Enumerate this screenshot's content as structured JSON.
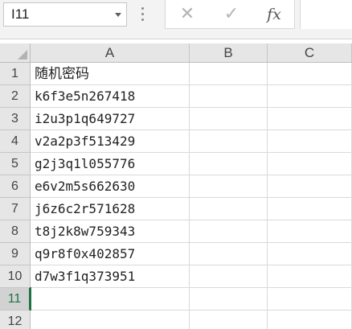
{
  "name_box": {
    "value": "I11"
  },
  "formula_bar": {
    "cancel_icon": "cancel-x-icon",
    "confirm_icon": "check-icon",
    "fx_label": "fx",
    "value": ""
  },
  "columns": [
    "A",
    "B",
    "C"
  ],
  "rows": [
    {
      "num": "1",
      "a": "随机密码"
    },
    {
      "num": "2",
      "a": "k6f3e5n267418"
    },
    {
      "num": "3",
      "a": "i2u3p1q649727"
    },
    {
      "num": "4",
      "a": "v2a2p3f513429"
    },
    {
      "num": "5",
      "a": "g2j3q1l055776"
    },
    {
      "num": "6",
      "a": "e6v2m5s662630"
    },
    {
      "num": "7",
      "a": "j6z6c2r571628"
    },
    {
      "num": "8",
      "a": "t8j2k8w759343"
    },
    {
      "num": "9",
      "a": "q9r8f0x402857"
    },
    {
      "num": "10",
      "a": "d7w3f1q373951"
    },
    {
      "num": "11",
      "a": ""
    },
    {
      "num": "12",
      "a": ""
    }
  ],
  "active_row": "11",
  "colors": {
    "excel_green": "#217346",
    "header_bg": "#e6e6e6",
    "grid_line": "#d9d9d9"
  }
}
